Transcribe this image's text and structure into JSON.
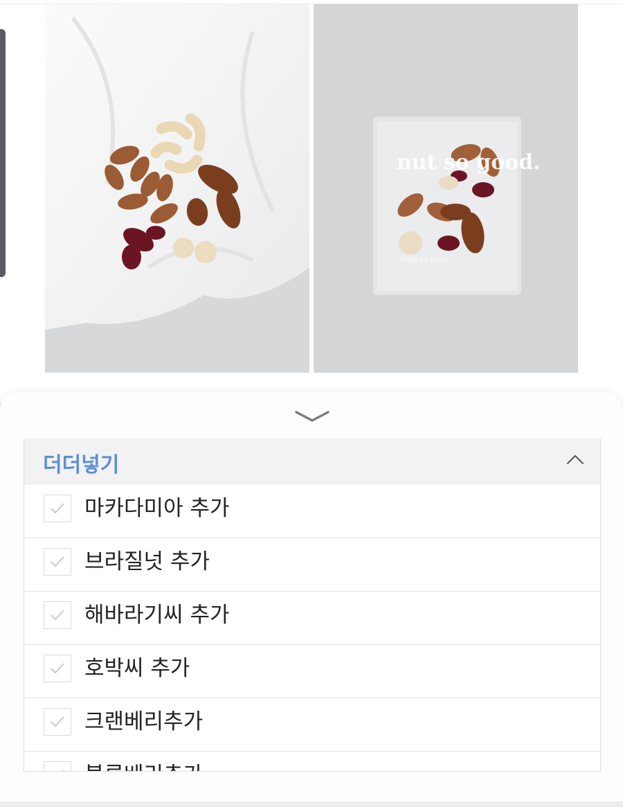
{
  "product_images": [
    {
      "icon": "mixed-nuts-on-cloth-photo"
    },
    {
      "icon": "nuts-pack-photo",
      "brand_text": "nut so good.",
      "sub_text": "Daily so good"
    }
  ],
  "sheet": {
    "collapse_icon": "chevron-down-icon",
    "group": {
      "title": "더더넣기",
      "toggle_icon": "chevron-up-icon",
      "options": [
        {
          "label": "마카다미아 추가",
          "checked": false
        },
        {
          "label": "브라질넛 추가",
          "checked": false
        },
        {
          "label": "해바라기씨 추가",
          "checked": false
        },
        {
          "label": "호박씨 추가",
          "checked": false
        },
        {
          "label": "크랜베리추가",
          "checked": false
        },
        {
          "label": "블루베리추가",
          "checked": false
        }
      ]
    }
  },
  "colors": {
    "accent": "#5f8fd1",
    "text": "#222222",
    "header_bg": "#f2f2f3",
    "checkmark": "#c9c9c9"
  }
}
